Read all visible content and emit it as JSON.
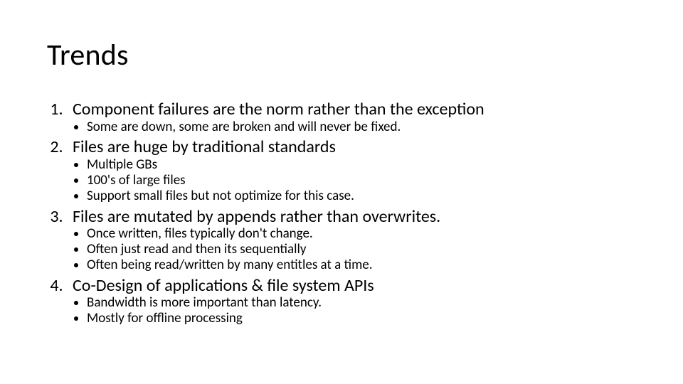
{
  "title": "Trends",
  "items": [
    {
      "text": "Component failures are the norm rather than the exception",
      "sub": [
        "Some are down, some are broken and will never be fixed."
      ]
    },
    {
      "text": "Files are huge by traditional standards",
      "sub": [
        "Multiple GBs",
        "100's of large files",
        "Support small files but not optimize for this case."
      ]
    },
    {
      "text": "Files are mutated by appends rather than overwrites.",
      "sub": [
        "Once written, files typically don't change.",
        "Often just read and then its sequentially",
        "Often being read/written by many entitles at a time."
      ]
    },
    {
      "text": "Co-Design of applications & file system APIs",
      "sub": [
        "Bandwidth is more important than latency.",
        "Mostly for offline processing"
      ]
    }
  ]
}
